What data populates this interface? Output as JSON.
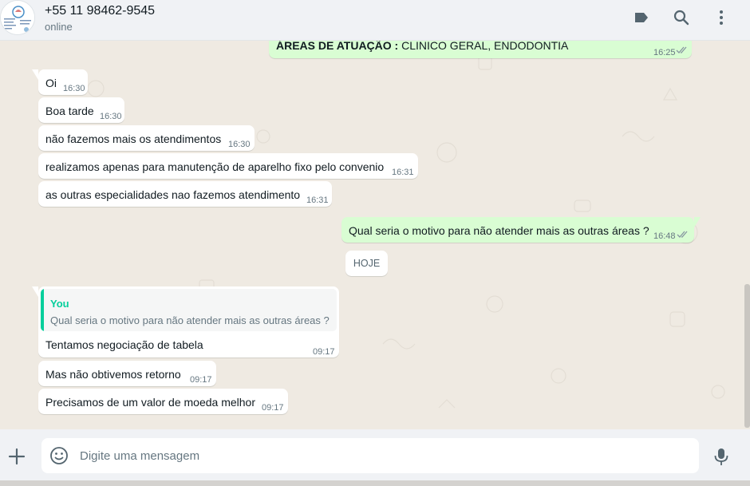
{
  "header": {
    "contact_name": "+55 11 98462-9545",
    "status": "online",
    "icons": [
      "label-icon",
      "search-icon",
      "menu-icon"
    ]
  },
  "messages": {
    "top_partial": {
      "text_bold": "ÁREAS DE ATUAÇÃO :",
      "text_rest": " CLINICO GERAL, ENDODONTIA",
      "time": "16:25"
    },
    "m1": {
      "text": "Oi",
      "time": "16:30"
    },
    "m2": {
      "text": "Boa tarde",
      "time": "16:30"
    },
    "m3": {
      "text": "não fazemos mais os atendimentos",
      "time": "16:30"
    },
    "m4": {
      "text": "realizamos apenas para manutenção de aparelho fixo pelo convenio",
      "time": "16:31"
    },
    "m5": {
      "text": "as outras especialidades nao fazemos atendimento",
      "time": "16:31"
    },
    "m6": {
      "text": "Qual seria o motivo para não atender mais as outras áreas ?",
      "time": "16:48"
    },
    "date_divider": "HOJE",
    "m7": {
      "quote_author": "You",
      "quote_text": "Qual seria o motivo para não atender mais as outras áreas ?",
      "text": "Tentamos negociação de tabela",
      "time": "09:17"
    },
    "m8": {
      "text": "Mas não obtivemos retorno",
      "time": "09:17"
    },
    "m9": {
      "text": "Precisamos de um valor de moeda melhor",
      "time": "09:17"
    }
  },
  "footer": {
    "placeholder": "Digite uma mensagem",
    "icons": [
      "plus-icon",
      "emoji-icon",
      "mic-icon"
    ]
  },
  "colors": {
    "outgoing": "#d9fdd3",
    "incoming": "#ffffff",
    "background": "#efeae2",
    "accent": "#06cf9c",
    "read_ticks": "#8696a0"
  }
}
